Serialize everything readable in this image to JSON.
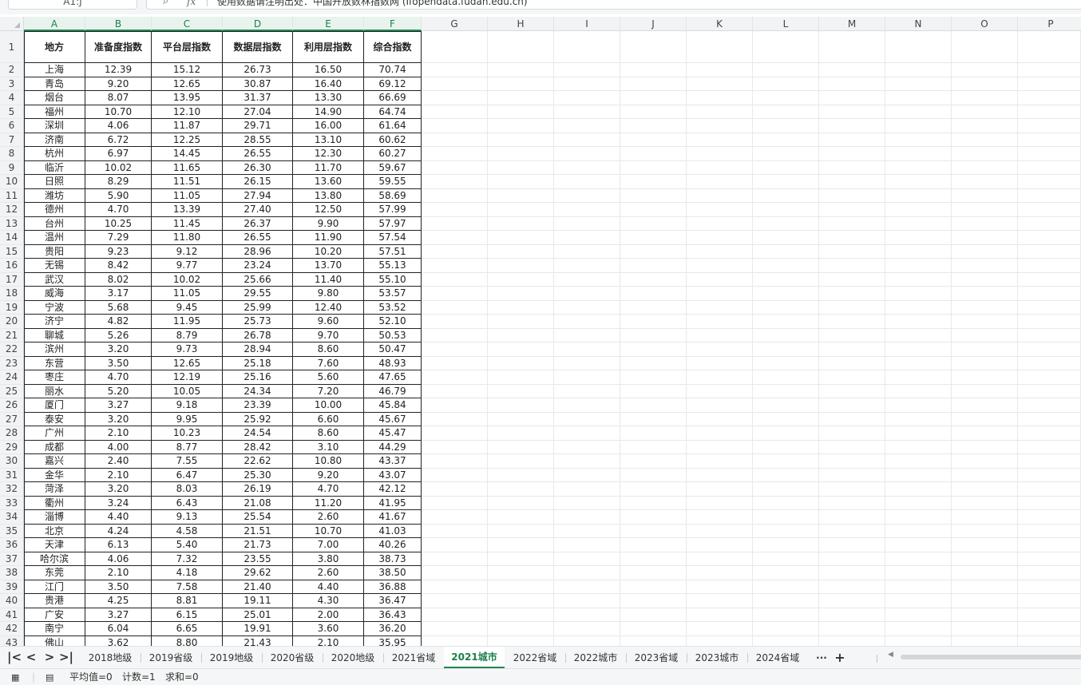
{
  "formula_bar": {
    "name_box": "A1:J",
    "search_icon": "search-icon",
    "fx_label": "fx",
    "formula_text": "使用数据请注明出处：中国开放数林指数网 (Ifopendata.fudan.edu.cn)"
  },
  "columns": [
    "A",
    "B",
    "C",
    "D",
    "E",
    "F",
    "G",
    "H",
    "I",
    "J",
    "K",
    "L",
    "M",
    "N",
    "O",
    "P"
  ],
  "table": {
    "headers": [
      "地方",
      "准备度指数",
      "平台层指数",
      "数据层指数",
      "利用层指数",
      "综合指数"
    ],
    "rows": [
      [
        "上海",
        "12.39",
        "15.12",
        "26.73",
        "16.50",
        "70.74"
      ],
      [
        "青岛",
        "9.20",
        "12.65",
        "30.87",
        "16.40",
        "69.12"
      ],
      [
        "烟台",
        "8.07",
        "13.95",
        "31.37",
        "13.30",
        "66.69"
      ],
      [
        "福州",
        "10.70",
        "12.10",
        "27.04",
        "14.90",
        "64.74"
      ],
      [
        "深圳",
        "4.06",
        "11.87",
        "29.71",
        "16.00",
        "61.64"
      ],
      [
        "济南",
        "6.72",
        "12.25",
        "28.55",
        "13.10",
        "60.62"
      ],
      [
        "杭州",
        "6.97",
        "14.45",
        "26.55",
        "12.30",
        "60.27"
      ],
      [
        "临沂",
        "10.02",
        "11.65",
        "26.30",
        "11.70",
        "59.67"
      ],
      [
        "日照",
        "8.29",
        "11.51",
        "26.15",
        "13.60",
        "59.55"
      ],
      [
        "潍坊",
        "5.90",
        "11.05",
        "27.94",
        "13.80",
        "58.69"
      ],
      [
        "德州",
        "4.70",
        "13.39",
        "27.40",
        "12.50",
        "57.99"
      ],
      [
        "台州",
        "10.25",
        "11.45",
        "26.37",
        "9.90",
        "57.97"
      ],
      [
        "温州",
        "7.29",
        "11.80",
        "26.55",
        "11.90",
        "57.54"
      ],
      [
        "贵阳",
        "9.23",
        "9.12",
        "28.96",
        "10.20",
        "57.51"
      ],
      [
        "无锡",
        "8.42",
        "9.77",
        "23.24",
        "13.70",
        "55.13"
      ],
      [
        "武汉",
        "8.02",
        "10.02",
        "25.66",
        "11.40",
        "55.10"
      ],
      [
        "威海",
        "3.17",
        "11.05",
        "29.55",
        "9.80",
        "53.57"
      ],
      [
        "宁波",
        "5.68",
        "9.45",
        "25.99",
        "12.40",
        "53.52"
      ],
      [
        "济宁",
        "4.82",
        "11.95",
        "25.73",
        "9.60",
        "52.10"
      ],
      [
        "聊城",
        "5.26",
        "8.79",
        "26.78",
        "9.70",
        "50.53"
      ],
      [
        "滨州",
        "3.20",
        "9.73",
        "28.94",
        "8.60",
        "50.47"
      ],
      [
        "东营",
        "3.50",
        "12.65",
        "25.18",
        "7.60",
        "48.93"
      ],
      [
        "枣庄",
        "4.70",
        "12.19",
        "25.16",
        "5.60",
        "47.65"
      ],
      [
        "丽水",
        "5.20",
        "10.05",
        "24.34",
        "7.20",
        "46.79"
      ],
      [
        "厦门",
        "3.27",
        "9.18",
        "23.39",
        "10.00",
        "45.84"
      ],
      [
        "泰安",
        "3.20",
        "9.95",
        "25.92",
        "6.60",
        "45.67"
      ],
      [
        "广州",
        "2.10",
        "10.23",
        "24.54",
        "8.60",
        "45.47"
      ],
      [
        "成都",
        "4.00",
        "8.77",
        "28.42",
        "3.10",
        "44.29"
      ],
      [
        "嘉兴",
        "2.40",
        "7.55",
        "22.62",
        "10.80",
        "43.37"
      ],
      [
        "金华",
        "2.10",
        "6.47",
        "25.30",
        "9.20",
        "43.07"
      ],
      [
        "菏泽",
        "3.20",
        "8.03",
        "26.19",
        "4.70",
        "42.12"
      ],
      [
        "衢州",
        "3.24",
        "6.43",
        "21.08",
        "11.20",
        "41.95"
      ],
      [
        "淄博",
        "4.40",
        "9.13",
        "25.54",
        "2.60",
        "41.67"
      ],
      [
        "北京",
        "4.24",
        "4.58",
        "21.51",
        "10.70",
        "41.03"
      ],
      [
        "天津",
        "6.13",
        "5.40",
        "21.73",
        "7.00",
        "40.26"
      ],
      [
        "哈尔滨",
        "4.06",
        "7.32",
        "23.55",
        "3.80",
        "38.73"
      ],
      [
        "东莞",
        "2.10",
        "4.18",
        "29.62",
        "2.60",
        "38.50"
      ],
      [
        "江门",
        "3.50",
        "7.58",
        "21.40",
        "4.40",
        "36.88"
      ],
      [
        "贵港",
        "4.25",
        "8.81",
        "19.11",
        "4.30",
        "36.47"
      ],
      [
        "广安",
        "3.27",
        "6.15",
        "25.01",
        "2.00",
        "36.43"
      ],
      [
        "南宁",
        "6.04",
        "6.65",
        "19.91",
        "3.60",
        "36.20"
      ],
      [
        "佛山",
        "3.62",
        "8.80",
        "21.43",
        "2.10",
        "35.95"
      ]
    ]
  },
  "sheet_tabs": {
    "nav": [
      "|<",
      "<",
      ">",
      ">|"
    ],
    "tabs": [
      "2018地级",
      "2019省级",
      "2019地级",
      "2020省级",
      "2020地级",
      "2021省域",
      "2021城市",
      "2022省域",
      "2022城市",
      "2023省域",
      "2023城市",
      "2024省域"
    ],
    "active_tab": "2021城市",
    "more_label": "···",
    "add_label": "+"
  },
  "status_bar": {
    "average": "平均值=0",
    "count": "计数=1",
    "sum": "求和=0"
  },
  "colors": {
    "accent": "#1e8a52",
    "header_bg": "#f2f3f5",
    "grid_line": "#e6e8eb"
  }
}
